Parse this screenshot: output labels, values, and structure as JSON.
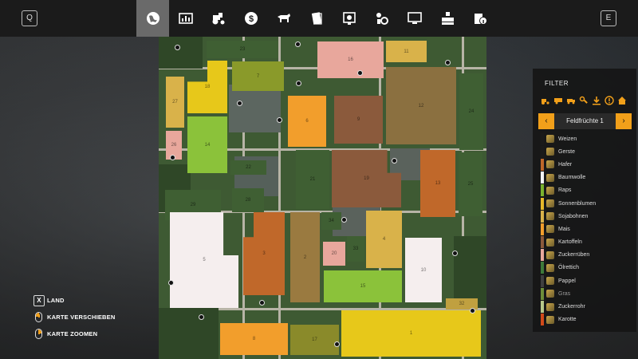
{
  "keys": {
    "left": "Q",
    "right": "E"
  },
  "top_tabs": [
    {
      "icon": "globe-map-icon",
      "active": true
    },
    {
      "icon": "statistics-icon",
      "active": false
    },
    {
      "icon": "tractor-icon",
      "active": false
    },
    {
      "icon": "finances-icon",
      "active": false
    },
    {
      "icon": "animals-icon",
      "active": false
    },
    {
      "icon": "contracts-icon",
      "active": false
    },
    {
      "icon": "calendar-icon",
      "active": false
    },
    {
      "icon": "production-icon",
      "active": false
    },
    {
      "icon": "help-icon",
      "active": false
    },
    {
      "icon": "settings-icon",
      "active": false
    },
    {
      "icon": "info-icon",
      "active": false
    }
  ],
  "filter": {
    "title": "FILTER",
    "selector_label": "Feldfrüchte 1",
    "prev": "‹",
    "next": "›",
    "crops": [
      {
        "name": "Weizen",
        "color": "#1a1a1a"
      },
      {
        "name": "Gerste",
        "color": "#1a1a1a"
      },
      {
        "name": "Hafer",
        "color": "#c0682a"
      },
      {
        "name": "Baumwolle",
        "color": "#f5f5f5"
      },
      {
        "name": "Raps",
        "color": "#7ab12e"
      },
      {
        "name": "Sonnenblumen",
        "color": "#e7b92a"
      },
      {
        "name": "Sojabohnen",
        "color": "#d9b24a"
      },
      {
        "name": "Mais",
        "color": "#f29e2c"
      },
      {
        "name": "Kartoffeln",
        "color": "#8b5a3c"
      },
      {
        "name": "Zuckerrüben",
        "color": "#e8a79c"
      },
      {
        "name": "Ölrettich",
        "color": "#3e7a3a"
      },
      {
        "name": "Pappel",
        "color": "#3f3f3f"
      },
      {
        "name": "Gras",
        "color": "#6e8e3a"
      },
      {
        "name": "Zuckerrohr",
        "color": "#b7c88a"
      },
      {
        "name": "Karotte",
        "color": "#d14a1a"
      }
    ]
  },
  "controls": [
    {
      "key": "X",
      "label": "LAND"
    },
    {
      "key": "mouse-left",
      "label": "KARTE VERSCHIEBEN"
    },
    {
      "key": "mouse-right",
      "label": "KARTE ZOOMEN"
    }
  ],
  "fields": [
    {
      "id": "23",
      "color": "#3f5f33"
    },
    {
      "id": "16",
      "color": "#e8a79c"
    },
    {
      "id": "11",
      "color": "#d9b24a"
    },
    {
      "id": "7",
      "color": "#8a9a2a"
    },
    {
      "id": "27",
      "color": "#d9b24a"
    },
    {
      "id": "18",
      "color": "#e7c81a"
    },
    {
      "id": "6",
      "color": "#f29e2c"
    },
    {
      "id": "9",
      "color": "#8b5a3c"
    },
    {
      "id": "12",
      "color": "#8b7040"
    },
    {
      "id": "24",
      "color": "#3f5f33"
    },
    {
      "id": "14",
      "color": "#8bc23a"
    },
    {
      "id": "26",
      "color": "#e8a79c"
    },
    {
      "id": "22",
      "color": "#3f5f33"
    },
    {
      "id": "21",
      "color": "#3f5f33"
    },
    {
      "id": "19",
      "color": "#8b5a3c"
    },
    {
      "id": "13",
      "color": "#c0682a"
    },
    {
      "id": "25",
      "color": "#3f5f33"
    },
    {
      "id": "29",
      "color": "#3f5f33"
    },
    {
      "id": "28",
      "color": "#3f5f33"
    },
    {
      "id": "5",
      "color": "#f5eeee"
    },
    {
      "id": "3",
      "color": "#c0682a"
    },
    {
      "id": "2",
      "color": "#9a7a40"
    },
    {
      "id": "34",
      "color": "#3f5f33"
    },
    {
      "id": "20",
      "color": "#e8a79c"
    },
    {
      "id": "33",
      "color": "#3f5f33"
    },
    {
      "id": "4",
      "color": "#d9b24a"
    },
    {
      "id": "10",
      "color": "#f5eeee"
    },
    {
      "id": "15",
      "color": "#8bc23a"
    },
    {
      "id": "32",
      "color": "#c0a040"
    },
    {
      "id": "8",
      "color": "#f29e2c"
    },
    {
      "id": "17",
      "color": "#8a8a2a"
    },
    {
      "id": "1",
      "color": "#e7c81a"
    }
  ]
}
